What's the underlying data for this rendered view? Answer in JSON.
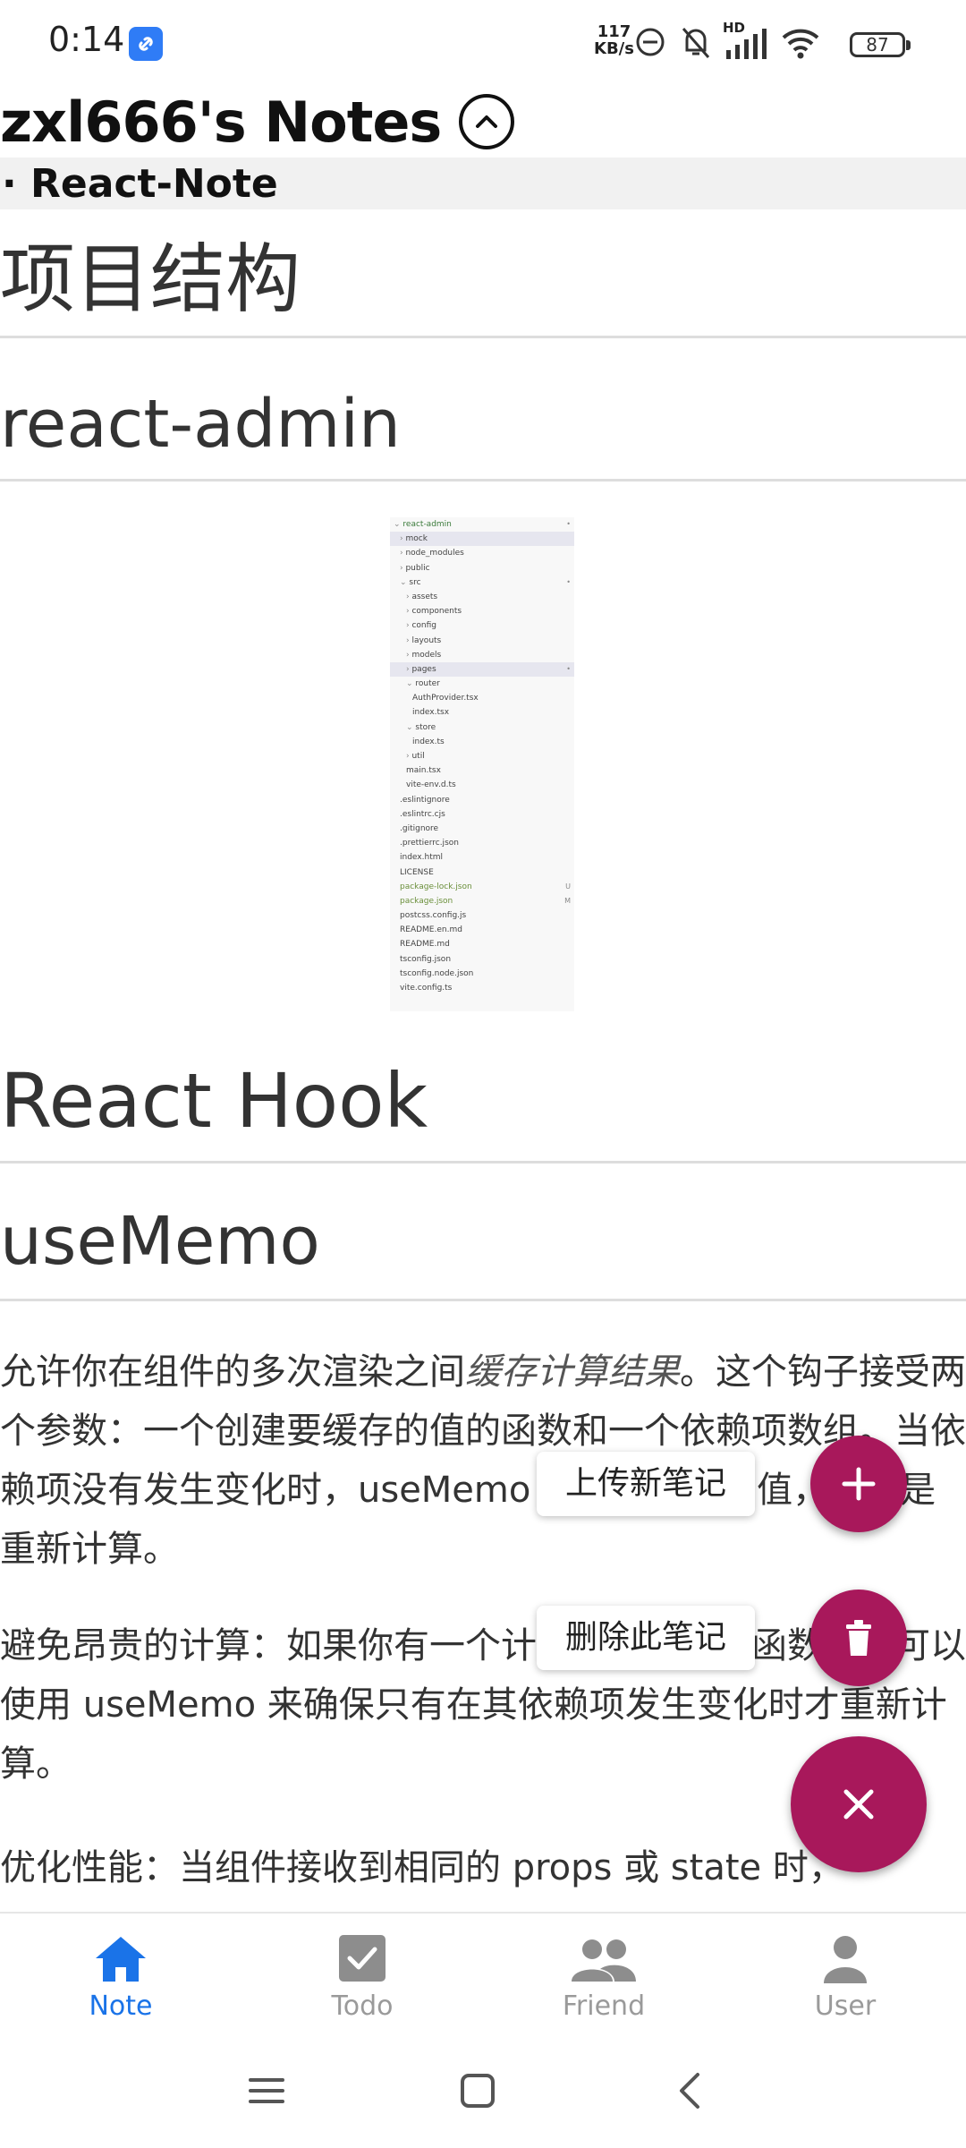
{
  "status_bar": {
    "time": "0:14",
    "net_speed_value": "117",
    "net_speed_unit": "KB/s",
    "hd_label": "HD",
    "battery": "87"
  },
  "header": {
    "title": "zxl666's Notes",
    "note_name": "· React-Note"
  },
  "content": {
    "h1_project": "项目结构",
    "h2_react_admin": "react-admin",
    "file_tree": [
      {
        "label": "react-admin",
        "indent": 0,
        "chev": "v",
        "mark": "•"
      },
      {
        "label": "mock",
        "indent": 1,
        "chev": ">",
        "mark": "",
        "sel": true
      },
      {
        "label": "node_modules",
        "indent": 1,
        "chev": ">",
        "mark": ""
      },
      {
        "label": "public",
        "indent": 1,
        "chev": ">",
        "mark": ""
      },
      {
        "label": "src",
        "indent": 1,
        "chev": "v",
        "mark": "•"
      },
      {
        "label": "assets",
        "indent": 2,
        "chev": ">",
        "mark": ""
      },
      {
        "label": "components",
        "indent": 2,
        "chev": ">",
        "mark": ""
      },
      {
        "label": "config",
        "indent": 2,
        "chev": ">",
        "mark": ""
      },
      {
        "label": "layouts",
        "indent": 2,
        "chev": ">",
        "mark": ""
      },
      {
        "label": "models",
        "indent": 2,
        "chev": ">",
        "mark": ""
      },
      {
        "label": "pages",
        "indent": 2,
        "chev": ">",
        "mark": "•",
        "sel": true
      },
      {
        "label": "router",
        "indent": 2,
        "chev": "v",
        "mark": ""
      },
      {
        "label": "AuthProvider.tsx",
        "indent": 3,
        "chev": "",
        "mark": ""
      },
      {
        "label": "index.tsx",
        "indent": 3,
        "chev": "",
        "mark": ""
      },
      {
        "label": "store",
        "indent": 2,
        "chev": "v",
        "mark": ""
      },
      {
        "label": "index.ts",
        "indent": 3,
        "chev": "",
        "mark": ""
      },
      {
        "label": "util",
        "indent": 2,
        "chev": ">",
        "mark": ""
      },
      {
        "label": "main.tsx",
        "indent": 2,
        "chev": "",
        "mark": ""
      },
      {
        "label": "vite-env.d.ts",
        "indent": 2,
        "chev": "",
        "mark": ""
      },
      {
        "label": ".eslintignore",
        "indent": 1,
        "chev": "",
        "mark": ""
      },
      {
        "label": ".eslintrc.cjs",
        "indent": 1,
        "chev": "",
        "mark": ""
      },
      {
        "label": ".gitignore",
        "indent": 1,
        "chev": "",
        "mark": ""
      },
      {
        "label": ".prettierrc.json",
        "indent": 1,
        "chev": "",
        "mark": ""
      },
      {
        "label": "index.html",
        "indent": 1,
        "chev": "",
        "mark": ""
      },
      {
        "label": "LICENSE",
        "indent": 1,
        "chev": "",
        "mark": ""
      },
      {
        "label": "package-lock.json",
        "indent": 1,
        "chev": "",
        "mark": "U"
      },
      {
        "label": "package.json",
        "indent": 1,
        "chev": "",
        "mark": "M"
      },
      {
        "label": "postcss.config.js",
        "indent": 1,
        "chev": "",
        "mark": ""
      },
      {
        "label": "README.en.md",
        "indent": 1,
        "chev": "",
        "mark": ""
      },
      {
        "label": "README.md",
        "indent": 1,
        "chev": "",
        "mark": ""
      },
      {
        "label": "tsconfig.json",
        "indent": 1,
        "chev": "",
        "mark": ""
      },
      {
        "label": "tsconfig.node.json",
        "indent": 1,
        "chev": "",
        "mark": ""
      },
      {
        "label": "vite.config.ts",
        "indent": 1,
        "chev": "",
        "mark": ""
      }
    ],
    "h1_hook": "React Hook",
    "h2_usememo": "useMemo",
    "p1_a": "允许你在组件的多次渲染之间",
    "p1_em": "缓存计算结果",
    "p1_b": "。这个钩子接受两个参数：一个创建要缓存的值的函数和一个依赖项数组。当依赖项没有发生变化时，useMemo 会返回缓存的值，而不是重新计算。",
    "p2": "避免昂贵的计算：如果你有一个计算成本很高的函数，你可以使用 useMemo 来确保只有在其依赖项发生变化时才重新计算。",
    "p3": "优化性能：当组件接收到相同的 props 或 state 时，"
  },
  "fab_menu": {
    "upload_label": "上传新笔记",
    "delete_label": "删除此笔记"
  },
  "bottom_nav": {
    "items": [
      {
        "label": "Note",
        "icon": "home-icon",
        "active": true
      },
      {
        "label": "Todo",
        "icon": "checkbox-icon",
        "active": false
      },
      {
        "label": "Friend",
        "icon": "people-icon",
        "active": false
      },
      {
        "label": "User",
        "icon": "person-icon",
        "active": false
      }
    ]
  },
  "colors": {
    "accent": "#a8185b",
    "active_nav": "#1a73e8",
    "inactive_nav": "#9a9a9a"
  }
}
